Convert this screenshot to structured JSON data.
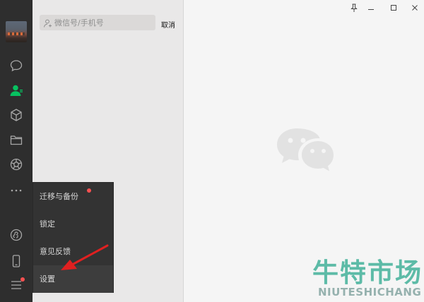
{
  "search": {
    "placeholder": "微信号/手机号",
    "value": "",
    "cancel_label": "取消"
  },
  "nav": {
    "items": [
      {
        "name": "chat",
        "icon": "chat-bubble-icon"
      },
      {
        "name": "contacts",
        "icon": "contacts-icon",
        "active": true
      },
      {
        "name": "favorites",
        "icon": "cube-icon"
      },
      {
        "name": "files",
        "icon": "folder-icon"
      },
      {
        "name": "moments",
        "icon": "aperture-icon"
      },
      {
        "name": "more",
        "icon": "more-dots-icon"
      },
      {
        "name": "mini-programs",
        "icon": "mini-program-icon"
      },
      {
        "name": "phone",
        "icon": "phone-icon"
      },
      {
        "name": "menu",
        "icon": "hamburger-icon",
        "badge": true
      }
    ]
  },
  "menu": {
    "items": [
      {
        "label": "迁移与备份",
        "badge": true
      },
      {
        "label": "锁定"
      },
      {
        "label": "意见反馈"
      },
      {
        "label": "设置",
        "active": true
      }
    ]
  },
  "window_controls": [
    "pin-icon",
    "minimize-icon",
    "maximize-icon",
    "close-icon"
  ],
  "watermark": {
    "chinese": "牛特市场",
    "english": "NIUTESHICHANG"
  },
  "colors": {
    "nav_bg": "#2e2e2e",
    "active_green": "#07c160",
    "badge_red": "#fa5151",
    "menu_bg": "#333333",
    "arrow_red": "#e02020"
  }
}
